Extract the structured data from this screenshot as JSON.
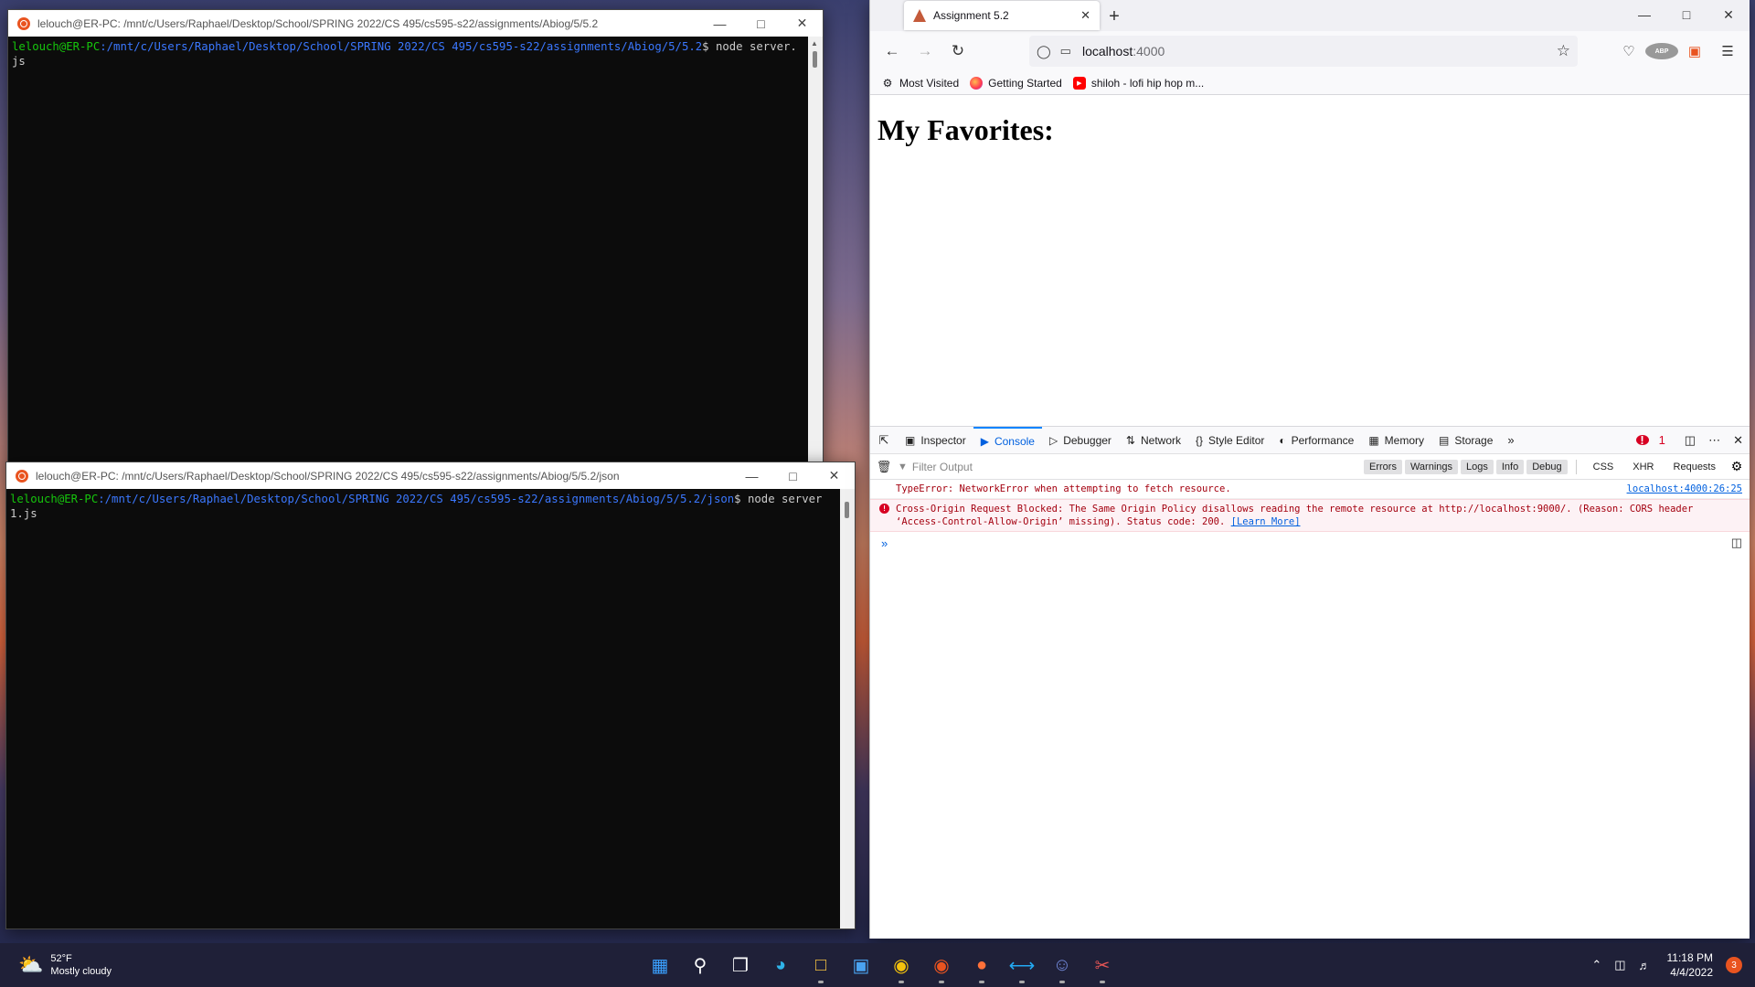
{
  "terminal1": {
    "title": "lelouch@ER-PC: /mnt/c/Users/Raphael/Desktop/School/SPRING 2022/CS 495/cs595-s22/assignments/Abiog/5/5.2",
    "prompt_user": "lelouch@ER-PC",
    "prompt_path": ":/mnt/c/Users/Raphael/Desktop/School/SPRING 2022/CS 495/cs595-s22/assignments/Abiog/5/5.2",
    "command": "$ node server.js"
  },
  "terminal2": {
    "title": "lelouch@ER-PC: /mnt/c/Users/Raphael/Desktop/School/SPRING 2022/CS 495/cs595-s22/assignments/Abiog/5/5.2/json",
    "prompt_user": "lelouch@ER-PC",
    "prompt_path": ":/mnt/c/Users/Raphael/Desktop/School/SPRING 2022/CS 495/cs595-s22/assignments/Abiog/5/5.2/json",
    "command": "$ node server1.js"
  },
  "browser": {
    "tab_title": "Assignment 5.2",
    "url_host": "localhost",
    "url_port": ":4000",
    "bookmarks": [
      "Most Visited",
      "Getting Started",
      "shiloh - lofi hip hop m..."
    ],
    "page_heading": "My Favorites:"
  },
  "devtools": {
    "tabs": [
      "Inspector",
      "Console",
      "Debugger",
      "Network",
      "Style Editor",
      "Performance",
      "Memory",
      "Storage"
    ],
    "active_tab": "Console",
    "error_count": "1",
    "filter_placeholder": "Filter Output",
    "filter_buttons": [
      "Errors",
      "Warnings",
      "Logs",
      "Info",
      "Debug"
    ],
    "filter_plain": [
      "CSS",
      "XHR",
      "Requests"
    ],
    "messages": [
      {
        "text": "TypeError: NetworkError when attempting to fetch resource.",
        "source": "localhost:4000:26:25"
      },
      {
        "text": "Cross-Origin Request Blocked: The Same Origin Policy disallows reading the remote resource at http://localhost:9000/. (Reason: CORS header ‘Access-Control-Allow-Origin’ missing). Status code: 200.",
        "link": "[Learn More]"
      }
    ]
  },
  "taskbar": {
    "weather_temp": "52°F",
    "weather_desc": "Mostly cloudy",
    "time": "11:18 PM",
    "date": "4/4/2022",
    "notification_count": "3"
  }
}
